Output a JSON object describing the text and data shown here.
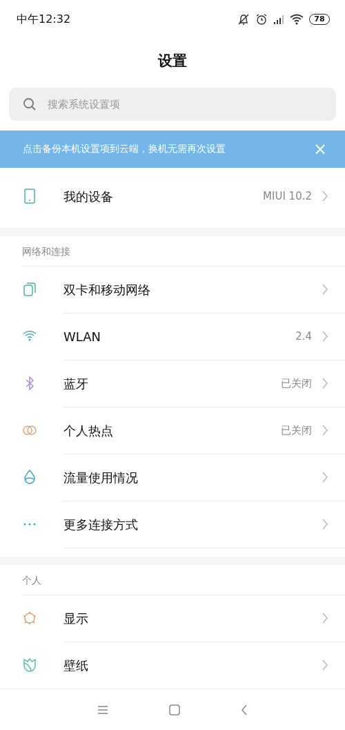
{
  "status_bar": {
    "time": "中午12:32",
    "battery": "78"
  },
  "title": "设置",
  "search": {
    "placeholder": "搜索系统设置项"
  },
  "banner": {
    "text": "点击备份本机设置项到云端，换机无需再次设置",
    "close": "×"
  },
  "device": {
    "label": "我的设备",
    "value": "MIUI 10.2"
  },
  "sections": [
    {
      "header": "网络和连接",
      "items": [
        {
          "label": "双卡和移动网络"
        },
        {
          "label": "WLAN",
          "value": "2.4"
        },
        {
          "label": "蓝牙",
          "value": "已关闭"
        },
        {
          "label": "个人热点",
          "value": "已关闭"
        },
        {
          "label": "流量使用情况"
        },
        {
          "label": "更多连接方式"
        }
      ]
    },
    {
      "header": "个人",
      "items": [
        {
          "label": "显示"
        },
        {
          "label": "壁纸"
        }
      ]
    }
  ]
}
